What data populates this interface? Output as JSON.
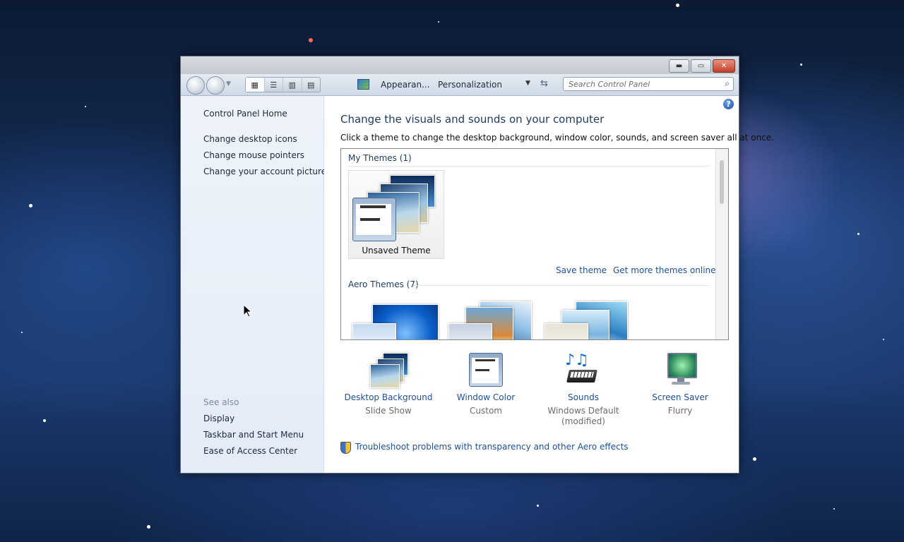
{
  "window": {
    "title_buttons": {
      "minimize": "▬",
      "maximize": "▭",
      "close": "✕"
    }
  },
  "navbar": {
    "view_modes": [
      "▦",
      "☰",
      "▥",
      "▤"
    ],
    "breadcrumb": [
      "Appearan...",
      "Personalization"
    ],
    "search_placeholder": "Search Control Panel"
  },
  "sidebar": {
    "home": "Control Panel Home",
    "links": [
      "Change desktop icons",
      "Change mouse pointers",
      "Change your account picture"
    ],
    "see_also_label": "See also",
    "see_also": [
      "Display",
      "Taskbar and Start Menu",
      "Ease of Access Center"
    ]
  },
  "main": {
    "title": "Change the visuals and sounds on your computer",
    "description": "Click a theme to change the desktop background, window color, sounds, and screen saver all at once.",
    "my_themes_header": "My Themes (1)",
    "unsaved_theme": "Unsaved Theme",
    "save_theme": "Save theme",
    "get_more": "Get more themes online",
    "aero_themes_header": "Aero Themes (7)",
    "bottom": [
      {
        "title": "Desktop Background",
        "sub": "Slide Show"
      },
      {
        "title": "Window Color",
        "sub": "Custom"
      },
      {
        "title": "Sounds",
        "sub": "Windows Default (modified)"
      },
      {
        "title": "Screen Saver",
        "sub": "Flurry"
      }
    ],
    "troubleshoot": "Troubleshoot problems with transparency and other Aero effects"
  },
  "colors": {
    "link": "#1e4f9c",
    "sidebar_bg": "#e8f0fa",
    "title_text": "#1e3a5f"
  }
}
